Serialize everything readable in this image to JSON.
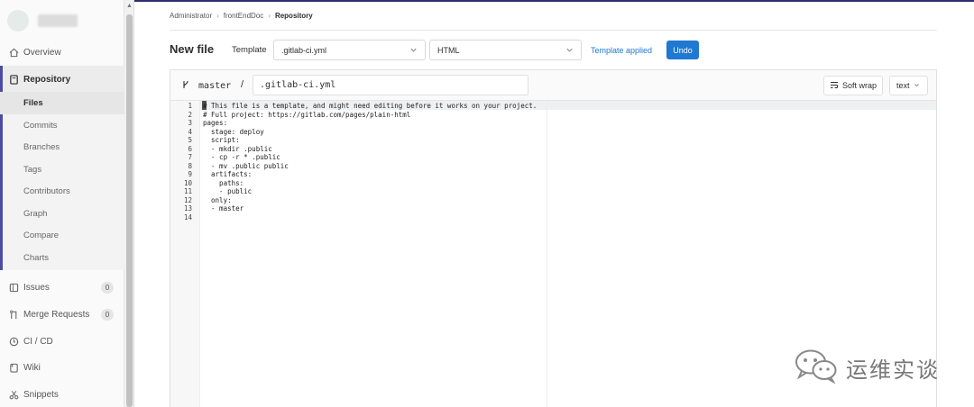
{
  "breadcrumb": {
    "items": [
      "Administrator",
      "frontEndDoc",
      "Repository"
    ]
  },
  "sidebar": {
    "items": [
      {
        "key": "overview",
        "label": "Overview",
        "icon": "home-icon"
      },
      {
        "key": "repository",
        "label": "Repository",
        "icon": "book-icon"
      },
      {
        "key": "issues",
        "label": "Issues",
        "icon": "issues-icon",
        "count": "0"
      },
      {
        "key": "merge_requests",
        "label": "Merge Requests",
        "icon": "merge-request-icon",
        "count": "0"
      },
      {
        "key": "cicd",
        "label": "CI / CD",
        "icon": "rocket-icon"
      },
      {
        "key": "wiki",
        "label": "Wiki",
        "icon": "wiki-icon"
      },
      {
        "key": "snippets",
        "label": "Snippets",
        "icon": "scissors-icon"
      }
    ],
    "repository_sub": [
      "Files",
      "Commits",
      "Branches",
      "Tags",
      "Contributors",
      "Graph",
      "Compare",
      "Charts"
    ]
  },
  "header": {
    "title": "New file",
    "template_label": "Template",
    "template_select": ".gitlab-ci.yml",
    "type_select": "HTML",
    "template_applied": "Template applied",
    "undo_label": "Undo"
  },
  "editor": {
    "branch": "master",
    "slash": "/",
    "filename": ".gitlab-ci.yml",
    "soft_wrap_label": "Soft wrap",
    "mode_label": "text",
    "lines": [
      "# This file is a template, and might need editing before it works on your project.",
      "# Full project: https://gitlab.com/pages/plain-html",
      "pages:",
      "  stage: deploy",
      "  script:",
      "  - mkdir .public",
      "  - cp -r * .public",
      "  - mv .public public",
      "  artifacts:",
      "    paths:",
      "    - public",
      "  only:",
      "  - master",
      ""
    ]
  },
  "watermark": {
    "text": "运维实谈"
  },
  "colors": {
    "accent": "#1f78d1",
    "sidebar_active": "#4b4ba3"
  }
}
